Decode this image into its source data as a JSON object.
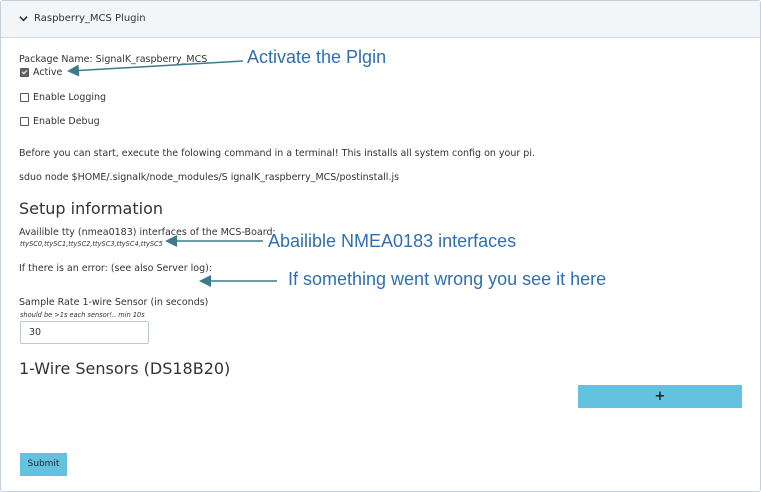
{
  "plugin": {
    "title": "Raspberry_MCS Plugin",
    "package_name": "Package Name: SignalK_raspberry_MCS"
  },
  "options": [
    {
      "label": "Active",
      "checked": true
    },
    {
      "label": "Enable Logging",
      "checked": false
    },
    {
      "label": "Enable Debug",
      "checked": false
    }
  ],
  "instructions": {
    "before_start": "Before you can start, execute the folowing command in a terminal! This installs all system config on your pi.",
    "command": "sduo node $HOME/.signalk/node_modules/S ignalK_raspberry_MCS/postinstall.js"
  },
  "setup": {
    "heading": "Setup information",
    "interfaces_label": "Availible tty (nmea0183) interfaces of the MCS-Board:",
    "interfaces_value": "ttySC0,ttySC1,ttySC2,ttySC3,ttySC4,ttySC5",
    "error_label": "If there is an error: (see also Server log):",
    "sample_rate_label": "Sample Rate 1-wire Sensor (in seconds)",
    "sample_rate_hint": "should be >1s each sensor!.. min 10s",
    "sample_rate_value": "30"
  },
  "sensors": {
    "heading": "1-Wire Sensors (DS18B20)",
    "add_label": "+"
  },
  "submit_label": "Submit",
  "annotations": {
    "activate": "Activate the Plgin",
    "interfaces": "Abailible NMEA0183 interfaces",
    "error": "If something went wrong you see it here"
  },
  "colors": {
    "accent": "#63c2de",
    "annotation": "#2f6fb0",
    "header_bg": "#f3f6f9"
  },
  "icons": {
    "header": "chevron-down-icon",
    "add": "plus-icon"
  }
}
